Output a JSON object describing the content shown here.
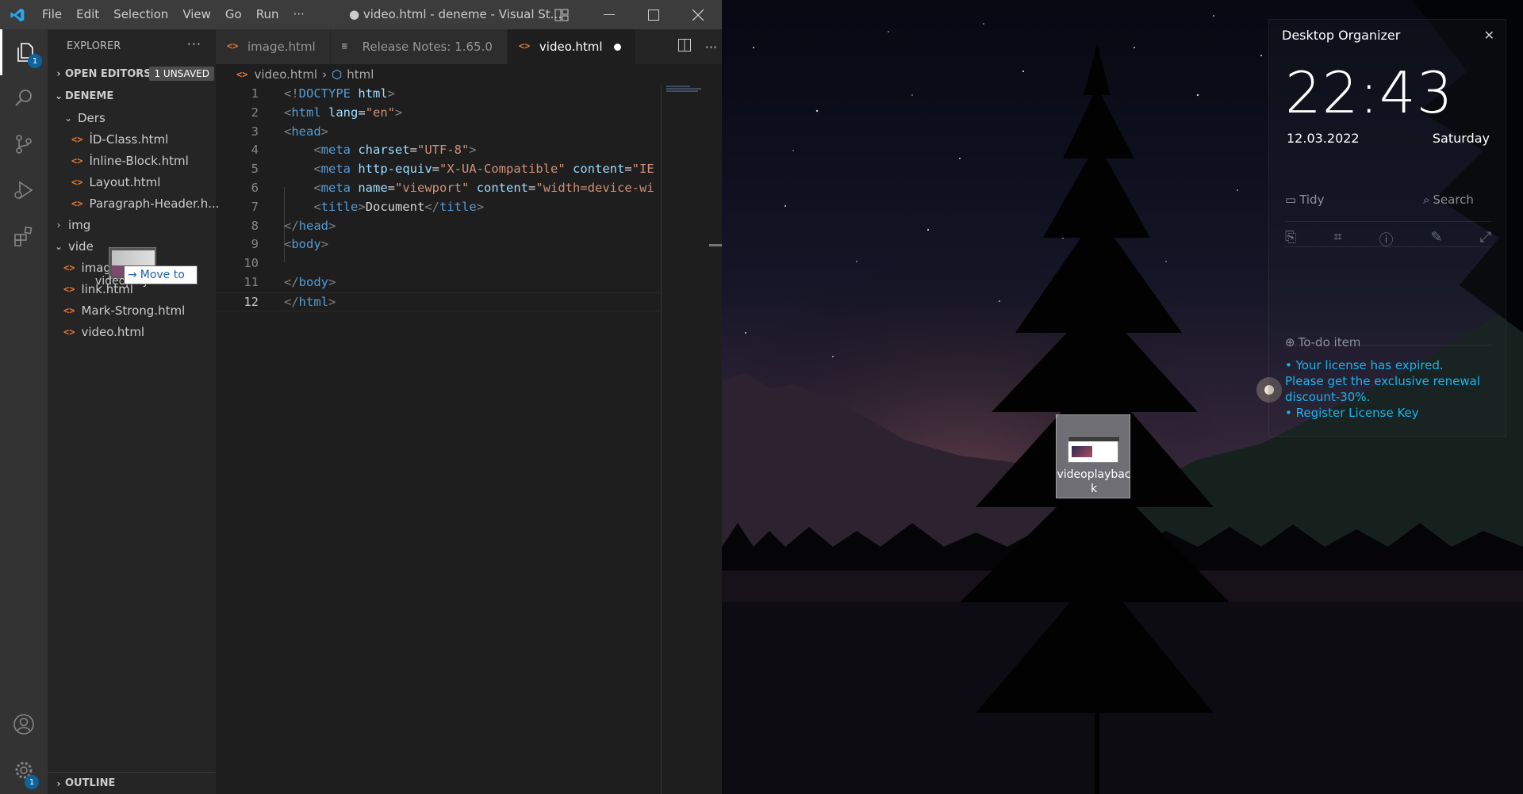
{
  "vscode": {
    "menu": [
      "File",
      "Edit",
      "Selection",
      "View",
      "Go",
      "Run",
      "···"
    ],
    "window_title": "● video.html - deneme - Visual St...",
    "explorer": {
      "title": "EXPLORER",
      "more": "···",
      "open_editors": "OPEN EDITORS",
      "unsaved_badge": "1 UNSAVED",
      "workspace": "DENEME",
      "folder_ders": "Ders",
      "ders_files": [
        "İD-Class.html",
        "İnline-Block.html",
        "Layout.html",
        "Paragraph-Header.h..."
      ],
      "folder_img": "img",
      "folder_video": "vide",
      "files": [
        "image.l",
        "link.html",
        "Mark-Strong.html",
        "video.html"
      ],
      "outline": "OUTLINE"
    },
    "drag": {
      "label": "videoplayback",
      "move_to": "Move to"
    },
    "badges": {
      "explorer": "1",
      "settings": "1"
    },
    "tabs": [
      {
        "label": "image.html",
        "icon": "html-icon"
      },
      {
        "label": "Release Notes: 1.65.0",
        "icon": "notes-icon"
      },
      {
        "label": "video.html",
        "icon": "html-icon"
      }
    ],
    "breadcrumb": {
      "file": "video.html",
      "symbol": "html"
    },
    "line_numbers": [
      "1",
      "2",
      "3",
      "4",
      "5",
      "6",
      "7",
      "8",
      "9",
      "10",
      "11",
      "12"
    ],
    "code": [
      [
        [
          "punc",
          "<!"
        ],
        [
          "tag",
          "DOCTYPE"
        ],
        [
          "text",
          " "
        ],
        [
          "attr",
          "html"
        ],
        [
          "punc",
          ">"
        ]
      ],
      [
        [
          "punc",
          "<"
        ],
        [
          "tag",
          "html"
        ],
        [
          "text",
          " "
        ],
        [
          "attr",
          "lang"
        ],
        [
          "text",
          "="
        ],
        [
          "str",
          "\"en\""
        ],
        [
          "punc",
          ">"
        ]
      ],
      [
        [
          "punc",
          "<"
        ],
        [
          "tag",
          "head"
        ],
        [
          "punc",
          ">"
        ]
      ],
      [
        [
          "text",
          "    "
        ],
        [
          "punc",
          "<"
        ],
        [
          "tag",
          "meta"
        ],
        [
          "text",
          " "
        ],
        [
          "attr",
          "charset"
        ],
        [
          "text",
          "="
        ],
        [
          "str",
          "\"UTF-8\""
        ],
        [
          "punc",
          ">"
        ]
      ],
      [
        [
          "text",
          "    "
        ],
        [
          "punc",
          "<"
        ],
        [
          "tag",
          "meta"
        ],
        [
          "text",
          " "
        ],
        [
          "attr",
          "http-equiv"
        ],
        [
          "text",
          "="
        ],
        [
          "str",
          "\"X-UA-Compatible\""
        ],
        [
          "text",
          " "
        ],
        [
          "attr",
          "content"
        ],
        [
          "text",
          "="
        ],
        [
          "str",
          "\"IE"
        ]
      ],
      [
        [
          "text",
          "    "
        ],
        [
          "punc",
          "<"
        ],
        [
          "tag",
          "meta"
        ],
        [
          "text",
          " "
        ],
        [
          "attr",
          "name"
        ],
        [
          "text",
          "="
        ],
        [
          "str",
          "\"viewport\""
        ],
        [
          "text",
          " "
        ],
        [
          "attr",
          "content"
        ],
        [
          "text",
          "="
        ],
        [
          "str",
          "\"width=device-wi"
        ]
      ],
      [
        [
          "text",
          "    "
        ],
        [
          "punc",
          "<"
        ],
        [
          "tag",
          "title"
        ],
        [
          "punc",
          ">"
        ],
        [
          "text",
          "Document"
        ],
        [
          "punc",
          "</"
        ],
        [
          "tag",
          "title"
        ],
        [
          "punc",
          ">"
        ]
      ],
      [
        [
          "punc",
          "</"
        ],
        [
          "tag",
          "head"
        ],
        [
          "punc",
          ">"
        ]
      ],
      [
        [
          "punc",
          "<"
        ],
        [
          "tag",
          "body"
        ],
        [
          "punc",
          ">"
        ]
      ],
      [],
      [
        [
          "punc",
          "</"
        ],
        [
          "tag",
          "body"
        ],
        [
          "punc",
          ">"
        ]
      ],
      [
        [
          "punc",
          "</"
        ],
        [
          "tag",
          "html"
        ],
        [
          "punc",
          ">"
        ]
      ]
    ]
  },
  "organizer": {
    "title": "Desktop Organizer",
    "close": "✕",
    "time": "22:43",
    "date": "12.03.2022",
    "day": "Saturday",
    "tidy": "Tidy",
    "search": "Search",
    "todo": "To-do item",
    "notice_line1": "• Your license has expired. Please get the exclusive renewal discount-30%.",
    "notice_line2": "• Register License Key"
  },
  "desktop_icon": {
    "label": "videoplayback"
  },
  "colors": {
    "accent": "#0e639c",
    "notice": "#17b5f0",
    "html_icon": "#e37933"
  }
}
